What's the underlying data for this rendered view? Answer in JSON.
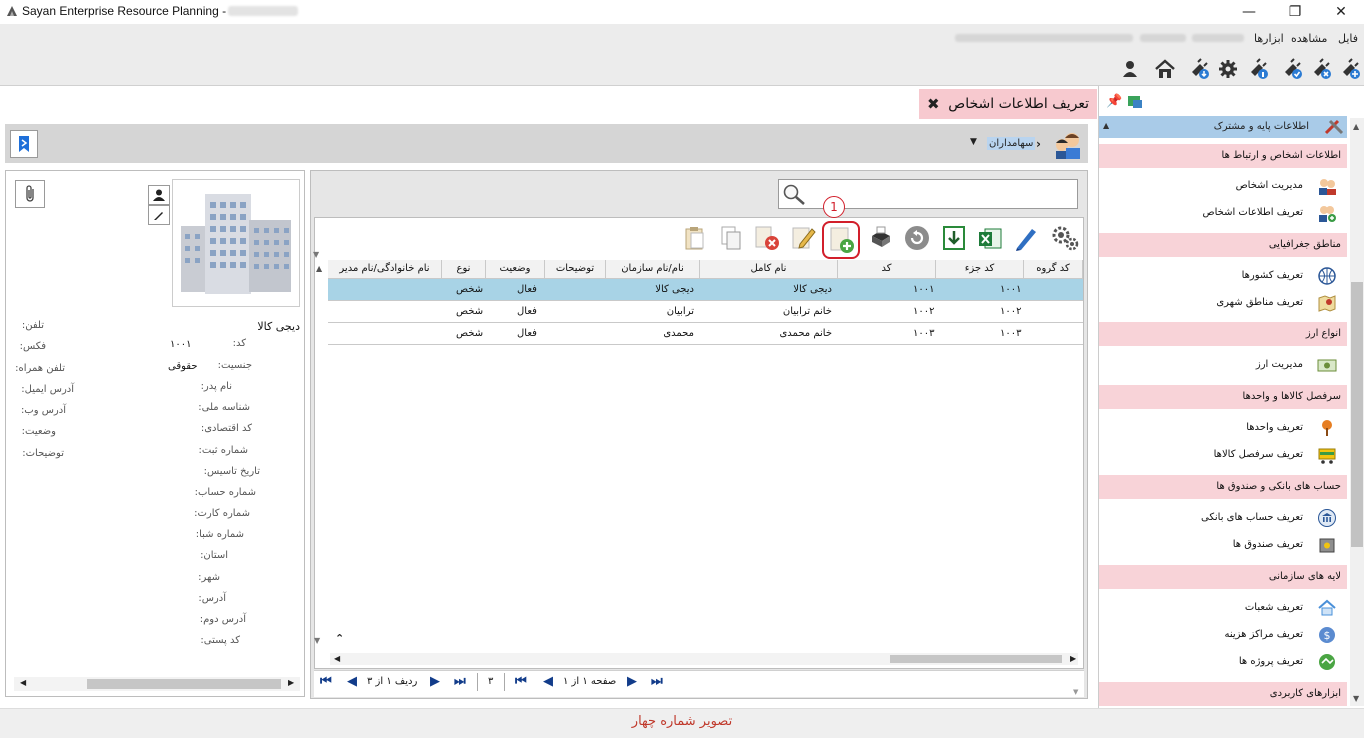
{
  "window": {
    "title": "Sayan Enterprise Resource Planning -"
  },
  "menu": {
    "items": [
      "فایل",
      "مشاهده",
      "ابزارها"
    ]
  },
  "tab": {
    "title": "تعریف اطلاعات اشخاص"
  },
  "breadcrumb": {
    "current": "سهامداران"
  },
  "detail": {
    "name": "دیجی کالا",
    "code_label": "کد:",
    "code_value": "۱۰۰۱",
    "gender_label": "جنسیت:",
    "gender_value": "حقوقی",
    "labels_mid": [
      "نام پدر:",
      "شناسه ملی:",
      "کد اقتصادی:",
      "شماره ثبت:",
      "تاریخ تاسیس:",
      "شماره حساب:",
      "شماره کارت:",
      "شماره شبا:",
      "استان:",
      "شهر:",
      "آدرس:",
      "آدرس دوم:",
      "کد پستی:"
    ],
    "labels_left": [
      "تلفن:",
      "فکس:",
      "تلفن همراه:",
      "آدرس ایمیل:",
      "آدرس وب:",
      "وضعیت:",
      "توضیحات:"
    ]
  },
  "toolbar": {
    "step_marker": "1"
  },
  "grid": {
    "headers": [
      "کد گروه",
      "کد جزء",
      "کد",
      "نام کامل",
      "نام/نام سازمان",
      "توضیحات",
      "وضعیت",
      "نوع",
      "نام خانوادگی/نام مدیر"
    ],
    "rows": [
      [
        "۱۰۰۱",
        "۱۰۰۱",
        "دیجی کالا",
        "دیجی کالا",
        "",
        "فعال",
        "شخص"
      ],
      [
        "۱۰۰۲",
        "۱۰۰۲",
        "خانم ترابیان",
        "ترابیان",
        "",
        "فعال",
        "شخص"
      ],
      [
        "۱۰۰۳",
        "۱۰۰۳",
        "خانم محمدی",
        "محمدی",
        "",
        "فعال",
        "شخص"
      ]
    ]
  },
  "pager": {
    "row_text": "ردیف ۱ از ۳",
    "count": "۳",
    "page_text": "صفحه ۱ از ۱"
  },
  "sidebar": {
    "top": "اطلاعات پایه و مشترک",
    "sections": [
      {
        "title": "اطلاعات اشخاص و ارتباط ها",
        "items": [
          "مدیریت اشخاص",
          "تعریف اطلاعات اشخاص"
        ]
      },
      {
        "title": "مناطق جغرافیایی",
        "items": [
          "تعریف کشورها",
          "تعریف مناطق شهری"
        ]
      },
      {
        "title": "انواع ارز",
        "items": [
          "مدیریت ارز"
        ]
      },
      {
        "title": "سرفصل کالاها و واحدها",
        "items": [
          "تعریف واحدها",
          "تعریف سرفصل کالاها"
        ]
      },
      {
        "title": "حساب های بانکی و صندوق ها",
        "items": [
          "تعریف حساب های بانکی",
          "تعریف صندوق ها"
        ]
      },
      {
        "title": "لایه های سازمانی",
        "items": [
          "تعریف شعبات",
          "تعریف مراکز هزینه",
          "تعریف پروژه ها"
        ]
      },
      {
        "title": "ابزارهای کاربردی",
        "items": []
      }
    ]
  },
  "caption": "تصویر شماره چهار",
  "colors": {
    "accent_pink": "#f7c9cf",
    "selected_row": "#a8d3e6",
    "link_blue": "#123c8a",
    "caption_red": "#c0392b"
  }
}
